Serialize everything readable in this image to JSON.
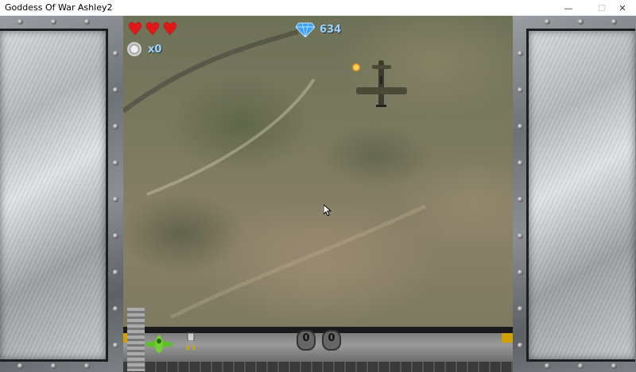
{
  "window": {
    "title": "Goddess Of War Ashley2",
    "controls": {
      "minimize": "—",
      "maximize": "☐",
      "close": "✕"
    }
  },
  "hud": {
    "lives": 3,
    "shield_count": "x0",
    "gems": "634"
  },
  "bottom_bar": {
    "slot1": "0",
    "slot2": "0"
  },
  "colors": {
    "heart": "#e01818",
    "hud_text": "#9fd3ff"
  }
}
